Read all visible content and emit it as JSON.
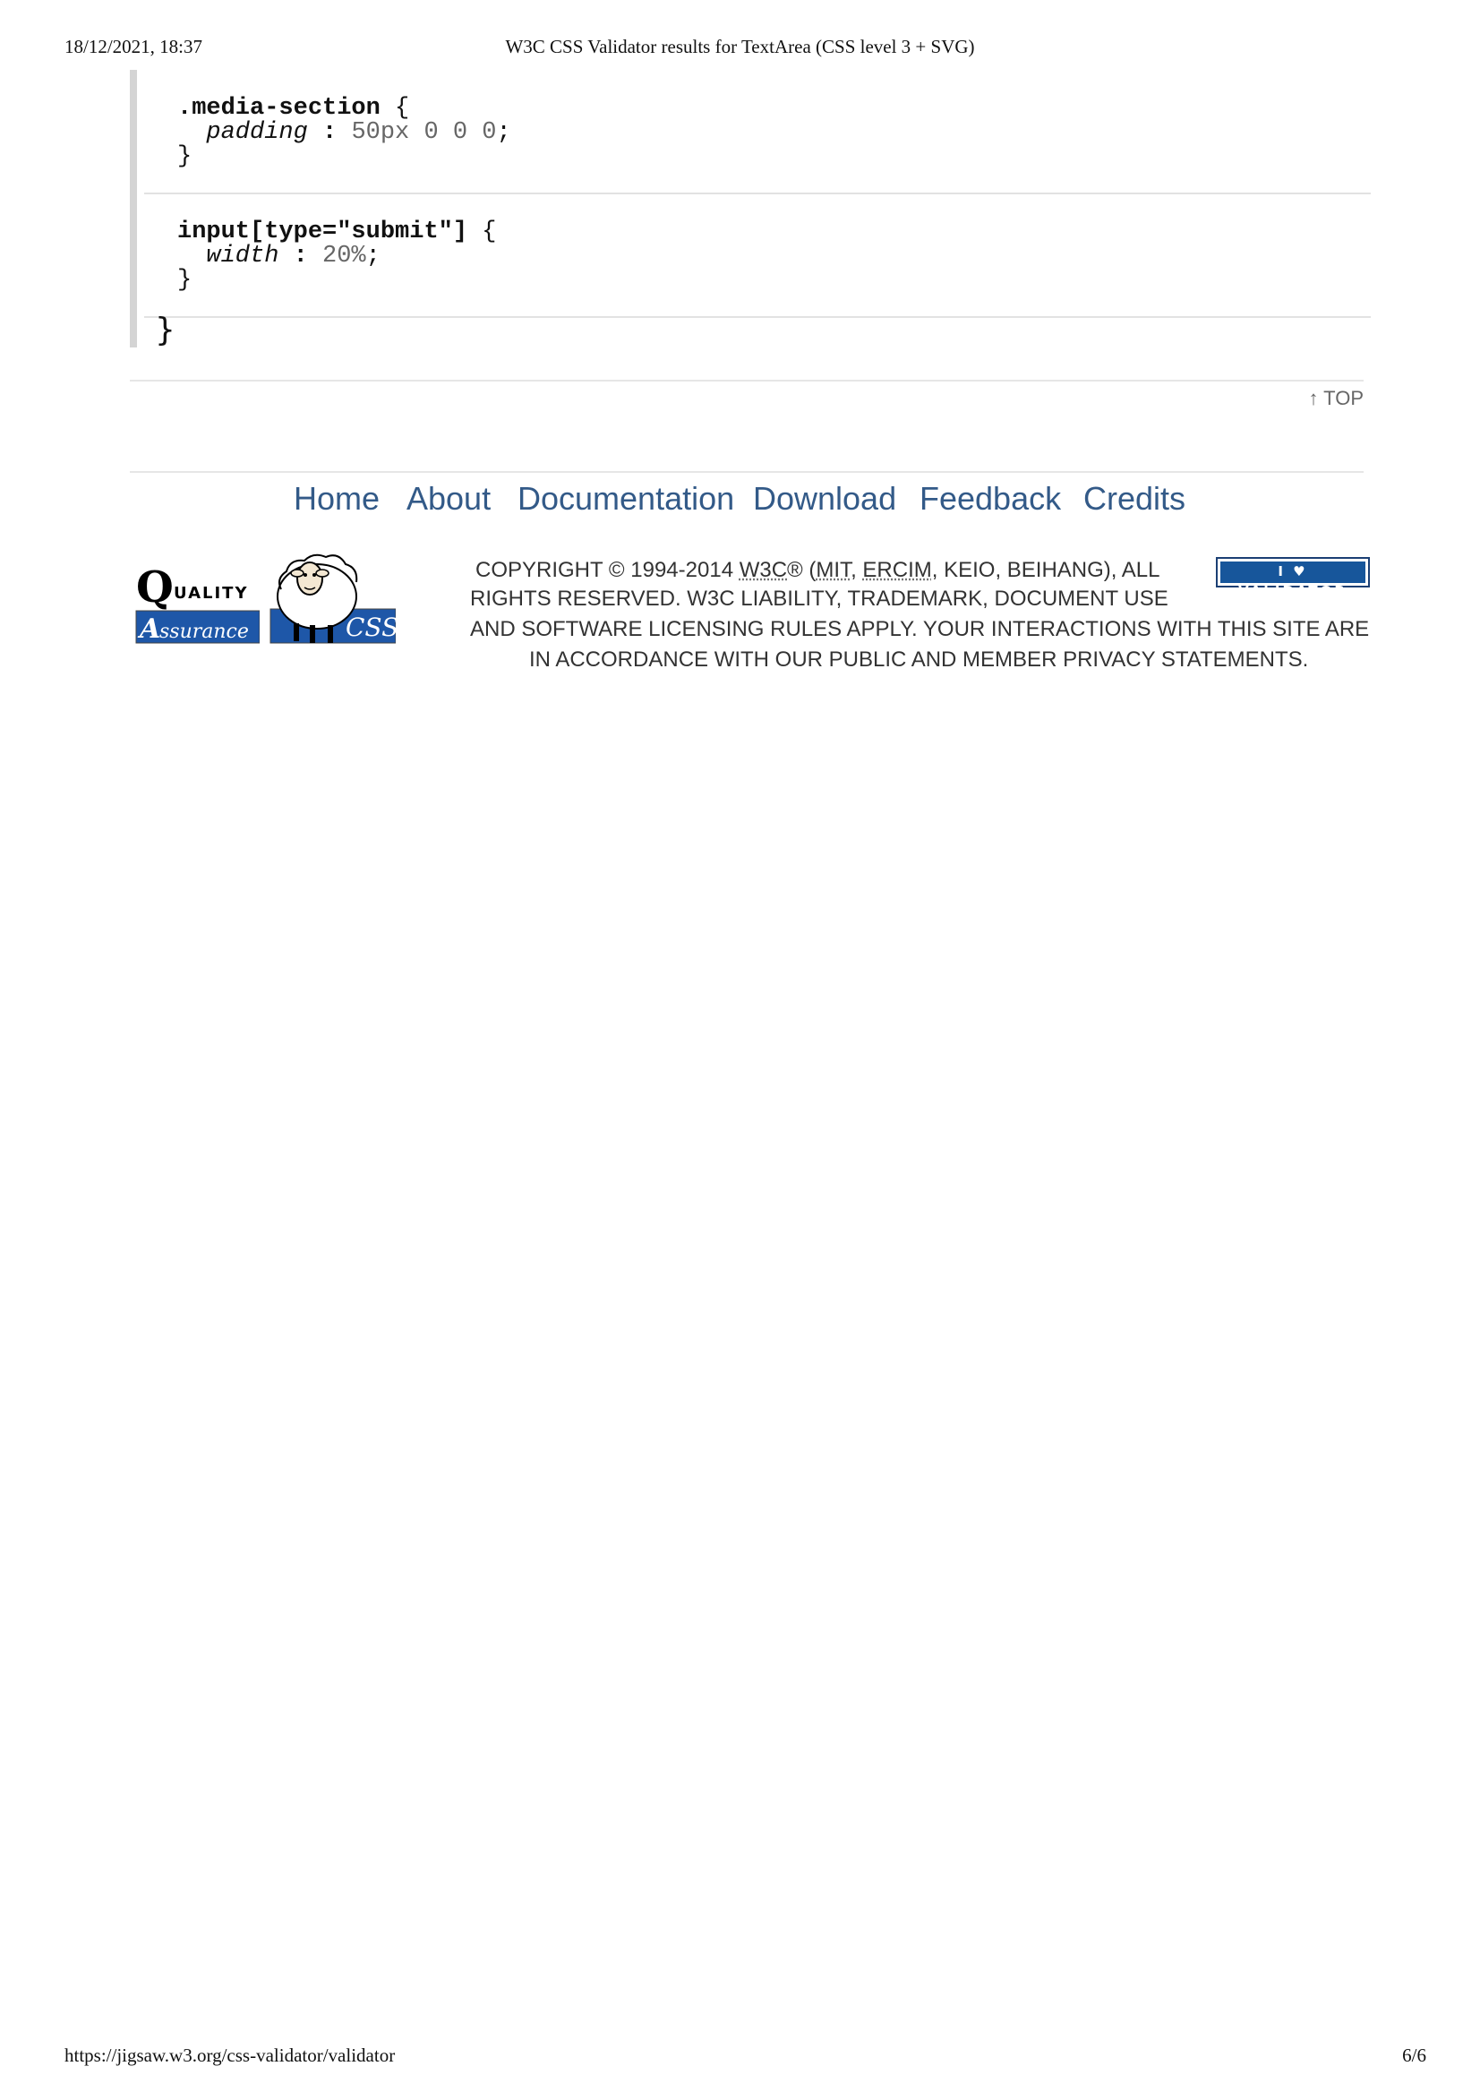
{
  "print_header": {
    "datetime": "18/12/2021, 18:37",
    "title": "W3C CSS Validator results for TextArea (CSS level 3 + SVG)"
  },
  "print_footer": {
    "url": "https://jigsaw.w3.org/css-validator/validator",
    "page": "6/6"
  },
  "css_rules": [
    {
      "selector": ".media-section",
      "open_brace": "{",
      "property": "padding",
      "colon": ":",
      "value": "50px 0 0 0",
      "semicolon": ";",
      "close_brace": "}"
    },
    {
      "selector": "input[type=\"submit\"]",
      "open_brace": "{",
      "property": "width",
      "colon": ":",
      "value": "20%",
      "semicolon": ";",
      "close_brace": "}"
    }
  ],
  "outer_close_brace": "}",
  "top_link": "↑ TOP",
  "nav": {
    "items": [
      "Home",
      "About",
      "Documentation",
      "Download",
      "Feedback",
      "Credits"
    ]
  },
  "logos": {
    "qa_letter": "Q",
    "qa_word_top": "UALITY",
    "qa_letter_a": "A",
    "qa_word_bottom": "ssurance",
    "css_label": "CSS",
    "validator_badge": "I ♥ VALIDATOR"
  },
  "copyright": {
    "line1_a": "COPYRIGHT © 1994-2014 ",
    "w3c": "W3C",
    "line1_b": "® (",
    "mit": "MIT",
    "sep1": ", ",
    "ercim": "ERCIM",
    "line1_c": ", KEIO, BEIHANG), ALL",
    "line2": "RIGHTS RESERVED. W3C LIABILITY, TRADEMARK, DOCUMENT USE",
    "line3": "AND SOFTWARE LICENSING RULES APPLY. YOUR INTERACTIONS WITH THIS SITE ARE",
    "line4": "IN ACCORDANCE WITH OUR PUBLIC AND MEMBER PRIVACY STATEMENTS."
  },
  "colors": {
    "link": "#335a88",
    "badge": "#17569b",
    "qa_blue": "#1e57a8"
  }
}
